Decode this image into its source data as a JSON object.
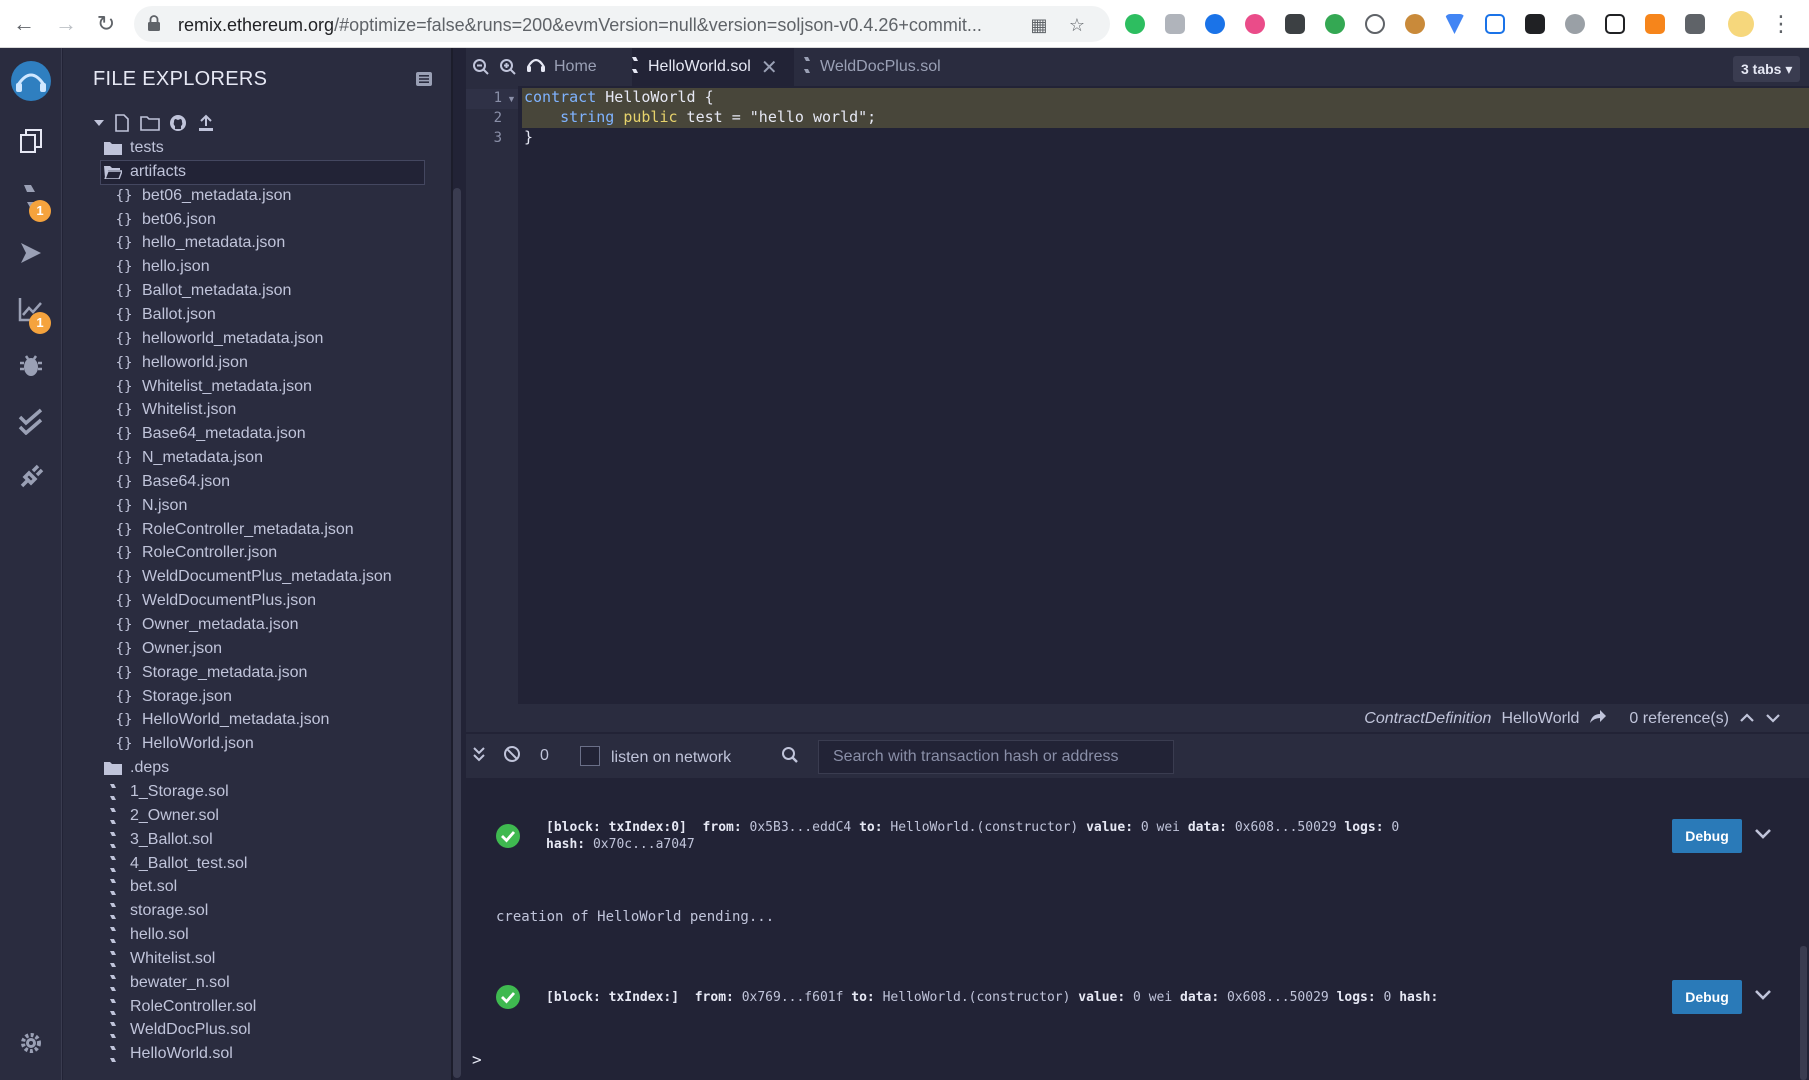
{
  "browser": {
    "url_host": "remix.ethereum.org",
    "url_rest": "/#optimize=false&runs=200&evmVersion=null&version=soljson-v0.4.26+commit..."
  },
  "colors": {
    "background": "#222336",
    "panel": "#2a2c3f",
    "accent_badge": "#f5a33d",
    "debug_button": "#2a7ab8",
    "success": "#3fb950",
    "code_highlight": "#48463a"
  },
  "icon_panel": {
    "items": [
      {
        "icon": "remix-logo-icon"
      },
      {
        "icon": "file-explorer-icon"
      },
      {
        "icon": "solidity-compiler-icon",
        "badge": "1"
      },
      {
        "icon": "deploy-run-icon"
      },
      {
        "icon": "analysis-icon",
        "badge": "1"
      },
      {
        "icon": "debugger-icon"
      },
      {
        "icon": "unit-testing-icon"
      },
      {
        "icon": "plugin-manager-icon"
      },
      {
        "icon": "settings-icon"
      }
    ]
  },
  "file_explorer": {
    "title": "FILE EXPLORERS",
    "tree": [
      {
        "name": "tests",
        "type": "folder"
      },
      {
        "name": "artifacts",
        "type": "folder-open",
        "selected": true
      },
      {
        "name": "bet06_metadata.json",
        "type": "json"
      },
      {
        "name": "bet06.json",
        "type": "json"
      },
      {
        "name": "hello_metadata.json",
        "type": "json"
      },
      {
        "name": "hello.json",
        "type": "json"
      },
      {
        "name": "Ballot_metadata.json",
        "type": "json"
      },
      {
        "name": "Ballot.json",
        "type": "json"
      },
      {
        "name": "helloworld_metadata.json",
        "type": "json"
      },
      {
        "name": "helloworld.json",
        "type": "json"
      },
      {
        "name": "Whitelist_metadata.json",
        "type": "json"
      },
      {
        "name": "Whitelist.json",
        "type": "json"
      },
      {
        "name": "Base64_metadata.json",
        "type": "json"
      },
      {
        "name": "N_metadata.json",
        "type": "json"
      },
      {
        "name": "Base64.json",
        "type": "json"
      },
      {
        "name": "N.json",
        "type": "json"
      },
      {
        "name": "RoleController_metadata.json",
        "type": "json"
      },
      {
        "name": "RoleController.json",
        "type": "json"
      },
      {
        "name": "WeldDocumentPlus_metadata.json",
        "type": "json"
      },
      {
        "name": "WeldDocumentPlus.json",
        "type": "json"
      },
      {
        "name": "Owner_metadata.json",
        "type": "json"
      },
      {
        "name": "Owner.json",
        "type": "json"
      },
      {
        "name": "Storage_metadata.json",
        "type": "json"
      },
      {
        "name": "Storage.json",
        "type": "json"
      },
      {
        "name": "HelloWorld_metadata.json",
        "type": "json"
      },
      {
        "name": "HelloWorld.json",
        "type": "json"
      },
      {
        "name": ".deps",
        "type": "folder"
      },
      {
        "name": "1_Storage.sol",
        "type": "sol"
      },
      {
        "name": "2_Owner.sol",
        "type": "sol"
      },
      {
        "name": "3_Ballot.sol",
        "type": "sol"
      },
      {
        "name": "4_Ballot_test.sol",
        "type": "sol"
      },
      {
        "name": "bet.sol",
        "type": "sol"
      },
      {
        "name": "storage.sol",
        "type": "sol"
      },
      {
        "name": "hello.sol",
        "type": "sol"
      },
      {
        "name": "Whitelist.sol",
        "type": "sol"
      },
      {
        "name": "bewater_n.sol",
        "type": "sol"
      },
      {
        "name": "RoleController.sol",
        "type": "sol"
      },
      {
        "name": "WeldDocPlus.sol",
        "type": "sol"
      },
      {
        "name": "HelloWorld.sol",
        "type": "sol"
      }
    ]
  },
  "tabs": {
    "home": "Home",
    "active": "HelloWorld.sol",
    "other": "WeldDocPlus.sol",
    "count": "3 tabs"
  },
  "editor": {
    "line_numbers": [
      "1",
      "2",
      "3"
    ],
    "line1": {
      "kw": "contract",
      "rest": " HelloWorld {"
    },
    "line2": {
      "indent": "    ",
      "kw": "string",
      "kw2": "public",
      "rest": " test = \"hello world\";"
    },
    "line3": "}"
  },
  "status": {
    "kind": "ContractDefinition",
    "name": "HelloWorld",
    "references": "0 reference(s)"
  },
  "terminal": {
    "pending_count": "0",
    "listen_label": "listen on network",
    "search_placeholder": "Search with transaction hash or address",
    "tx1": {
      "block_label": "[block: txIndex:0]",
      "from_label": "from:",
      "from": "0x5B3...eddC4",
      "to_label": "to:",
      "to": "HelloWorld.(constructor)",
      "value_label": "value:",
      "value": "0 wei",
      "data_label": "data:",
      "data": "0x608...50029",
      "logs_label": "logs:",
      "logs": "0",
      "hash_label": "hash:",
      "hash": "0x70c...a7047"
    },
    "pending_message": "creation of HelloWorld pending...",
    "tx2": {
      "block_label": "[block: txIndex:]",
      "from_label": "from:",
      "from": "0x769...f601f",
      "to_label": "to:",
      "to": "HelloWorld.(constructor)",
      "value_label": "value:",
      "value": "0 wei",
      "data_label": "data:",
      "data": "0x608...50029",
      "logs_label": "logs:",
      "logs": "0",
      "hash_label": "hash:"
    },
    "debug_label": "Debug",
    "prompt": ">"
  }
}
